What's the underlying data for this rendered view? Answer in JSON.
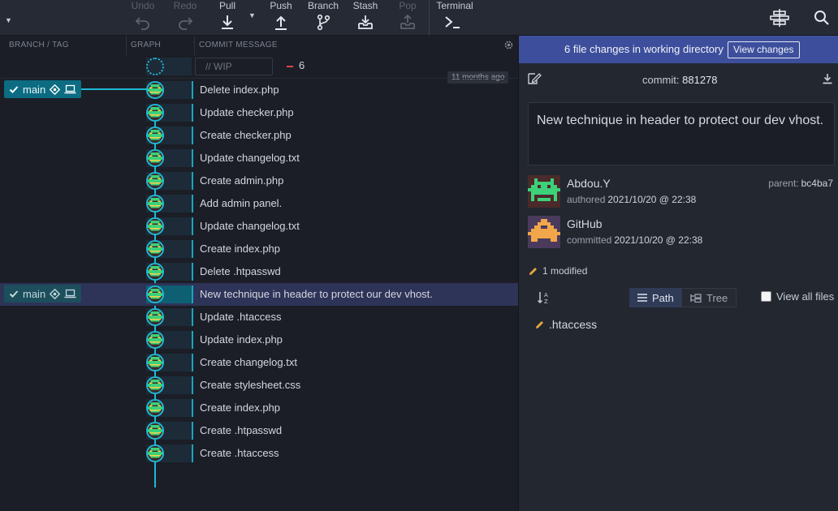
{
  "toolbar": {
    "undo": "Undo",
    "redo": "Redo",
    "pull": "Pull",
    "push": "Push",
    "branch": "Branch",
    "stash": "Stash",
    "pop": "Pop",
    "terminal": "Terminal"
  },
  "columns": {
    "branch_tag": "BRANCH / TAG",
    "graph": "GRAPH",
    "commit_message": "COMMIT MESSAGE"
  },
  "wip": {
    "placeholder": "// WIP",
    "count": "6",
    "time_ago": "11 months ago"
  },
  "branch_tags": [
    {
      "name": "main"
    },
    {
      "name": "main"
    }
  ],
  "commits": [
    "Delete index.php",
    "Update checker.php",
    "Create checker.php",
    "Update changelog.txt",
    "Create admin.php",
    "Add admin panel.",
    "Update changelog.txt",
    "Create index.php",
    "Delete .htpasswd",
    "New technique in header to protect our dev vhost.",
    "Update .htaccess",
    "Update index.php",
    "Create changelog.txt",
    "Create stylesheet.css",
    "Create index.php",
    "Create .htpasswd",
    "Create .htaccess"
  ],
  "selected_commit_index": 9,
  "details": {
    "banner_text": "6 file changes in working directory",
    "view_changes": "View changes",
    "commit_label": "commit:",
    "commit_sha": "881278",
    "message": "New technique in header to protect our dev vhost.",
    "author_name": "Abdou.Y",
    "authored_label": "authored",
    "authored_time": "2021/10/20 @ 22:38",
    "parent_label": "parent:",
    "parent_sha": "bc4ba7",
    "committer_name": "GitHub",
    "committed_label": "committed",
    "committed_time": "2021/10/20 @ 22:38",
    "modified_summary": "1 modified",
    "path_label": "Path",
    "tree_label": "Tree",
    "view_all_files": "View all files",
    "files": [
      ".htaccess"
    ]
  },
  "colors": {
    "accent": "#20b8d6",
    "banner": "#3d4f9c",
    "selected_row": "#2e3358",
    "deleted": "#e0424c",
    "modified": "#e8a73c"
  }
}
